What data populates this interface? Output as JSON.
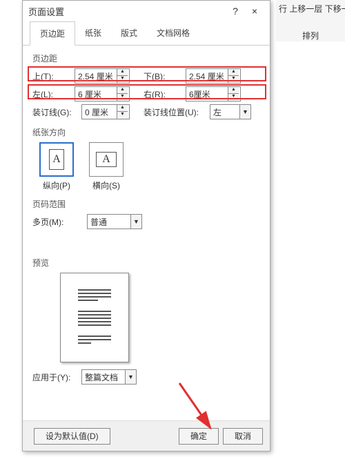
{
  "ribbon": {
    "t1": "行 上移一层 下移一层",
    "t2": "排列"
  },
  "dialog": {
    "title": "页面设置",
    "tabs": [
      "页边距",
      "纸张",
      "版式",
      "文档网格"
    ],
    "sect_margin": "页边距",
    "top": {
      "lbl": "上(T):",
      "val": "2.54 厘米"
    },
    "bottom": {
      "lbl": "下(B):",
      "val": "2.54 厘米"
    },
    "left": {
      "lbl": "左(L):",
      "val": "6 厘米"
    },
    "right": {
      "lbl": "右(R):",
      "val": "6厘米"
    },
    "gutter": {
      "lbl": "装订线(G):",
      "val": "0 厘米"
    },
    "gutterpos": {
      "lbl": "装订线位置(U):",
      "val": "左"
    },
    "sect_orient": "纸张方向",
    "portrait": "纵向(P)",
    "landscape": "横向(S)",
    "sect_range": "页码范围",
    "multi": {
      "lbl": "多页(M):",
      "val": "普通"
    },
    "sect_preview": "预览",
    "apply": {
      "lbl": "应用于(Y):",
      "val": "整篇文档"
    },
    "default": "设为默认值(D)",
    "ok": "确定",
    "cancel": "取消"
  }
}
